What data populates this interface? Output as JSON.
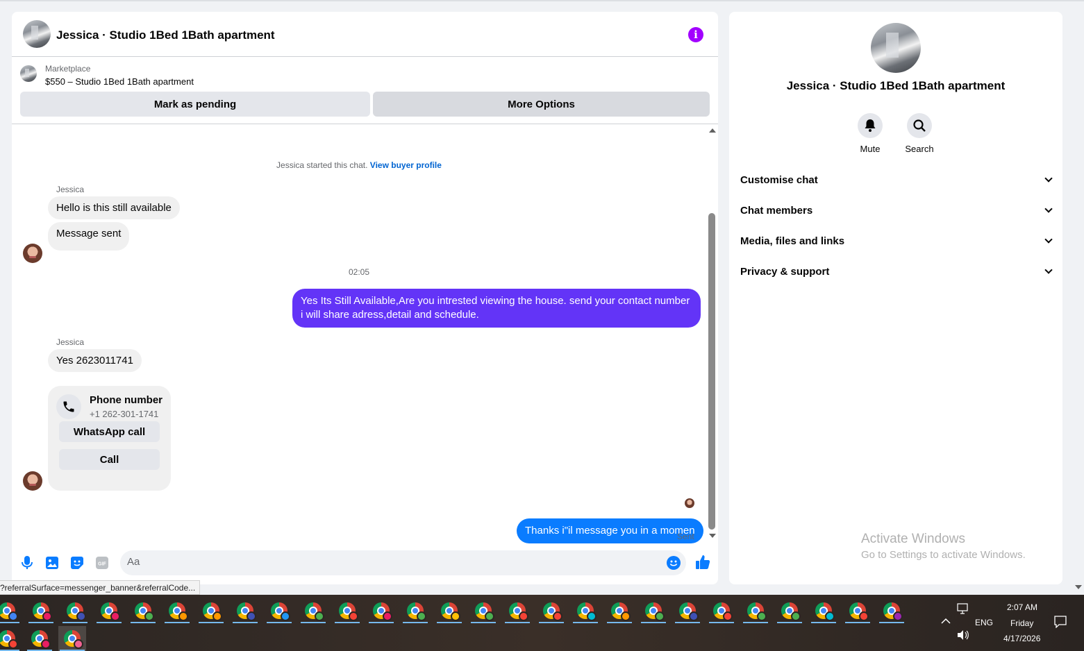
{
  "chat": {
    "title": "Jessica · Studio 1Bed 1Bath apartment",
    "marketplace_label": "Marketplace",
    "listing": "$550 – Studio 1Bed 1Bath apartment",
    "mark_pending_label": "Mark as pending",
    "more_options_label": "More Options",
    "system_text": "Jessica started this chat.",
    "view_buyer_profile": "View buyer profile",
    "timestamp": "02:05",
    "messages": [
      {
        "sender": "Jessica",
        "text": "Hello is this still available"
      },
      {
        "text": "Message sent"
      },
      {
        "from": "me",
        "text": "Yes Its Still Available,Are you intrested viewing the house. send your contact number i will share adress,detail and schedule."
      },
      {
        "sender": "Jessica",
        "text": "Yes 2623011741"
      },
      {
        "from": "me",
        "text": "Thanks i\"il message you in a momen"
      }
    ],
    "phone_card": {
      "title": "Phone number",
      "number": "+1 262-301-1741",
      "whatsapp_label": "WhatsApp call",
      "call_label": "Call"
    },
    "sent_status": "Sent",
    "composer_placeholder": "Aa",
    "colors": {
      "outgoing_purple": "#6334f7",
      "outgoing_blue": "#0a7cff",
      "accent": "#0084ff",
      "info_icon": "#a200ff"
    },
    "icons": [
      "info-icon",
      "microphone-icon",
      "image-icon",
      "sticker-icon",
      "gif-icon",
      "emoji-icon",
      "thumbs-up-icon",
      "phone-icon"
    ]
  },
  "info_panel": {
    "title": "Jessica · Studio 1Bed 1Bath apartment",
    "actions": [
      {
        "label": "Mute",
        "icon": "bell-icon"
      },
      {
        "label": "Search",
        "icon": "search-icon"
      }
    ],
    "menu": [
      {
        "label": "Customise chat"
      },
      {
        "label": "Chat members"
      },
      {
        "label": "Media, files and links"
      },
      {
        "label": "Privacy & support"
      }
    ]
  },
  "watermark": {
    "title": "Activate Windows",
    "subtitle": "Go to Settings to activate Windows."
  },
  "status_url": "?referralSurface=messenger_banner&referralCode...",
  "taskbar": {
    "app_icon": "chrome-icon",
    "language": "ENG",
    "time": "2:07 AM",
    "day": "Friday",
    "date": "4/17/2026",
    "profile_colors": [
      "#4285f4",
      "#e91e63",
      "#3f51b5",
      "#e91e63",
      "#4caf50",
      "#ff9800",
      "#ff9800",
      "#3f51b5",
      "#2196f3",
      "#4caf50",
      "#f44336",
      "#e91e63",
      "#4caf50",
      "#ffc107",
      "#4caf50",
      "#f44336",
      "#f44336",
      "#00bcd4",
      "#ff9800",
      "#4caf50",
      "#3f51b5",
      "#f44336",
      "#4caf50",
      "#4caf50",
      "#00bcd4",
      "#f44336",
      "#9c27b0",
      "#f44336",
      "#e91e63",
      "#f06292"
    ]
  }
}
